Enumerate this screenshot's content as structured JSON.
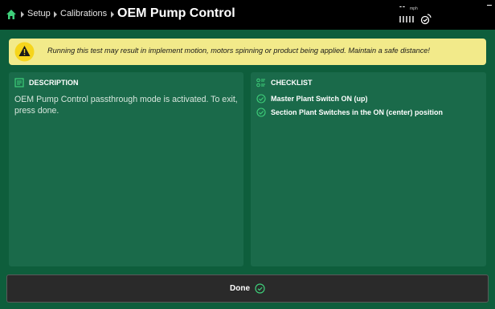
{
  "breadcrumb": {
    "items": [
      "Setup",
      "Calibrations"
    ],
    "title": "OEM Pump Control"
  },
  "status": {
    "speed_value": "--",
    "speed_unit": "mph"
  },
  "icons": {
    "home": "home-icon",
    "gps": "gps-satellite-icon",
    "warning": "warning-triangle-icon",
    "description": "document-icon",
    "checklist": "checklist-icon",
    "check": "check-circle-icon"
  },
  "warning": {
    "text": "Running this test may result in implement motion, motors spinning or product being applied. Maintain a safe distance!"
  },
  "description": {
    "heading": "DESCRIPTION",
    "body": "OEM Pump Control passthrough mode is activated. To exit, press done."
  },
  "checklist": {
    "heading": "CHECKLIST",
    "items": [
      "Master Plant Switch ON (up)",
      "Section Plant Switches in the ON (center) position"
    ]
  },
  "actions": {
    "done_label": "Done"
  },
  "colors": {
    "background": "#0e5e3c",
    "panel": "#1a6a4a",
    "accent": "#3ecf7a",
    "warning_bg": "#f2ea8a",
    "topbar": "#000000"
  }
}
